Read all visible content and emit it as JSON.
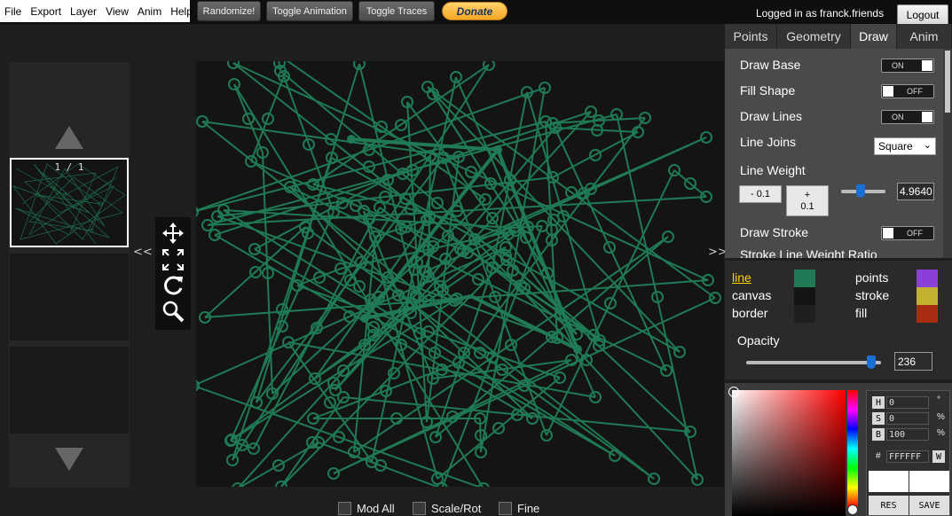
{
  "menu": [
    "File",
    "Export",
    "Layer",
    "View",
    "Anim",
    "Help"
  ],
  "toolbar": {
    "randomize": "Randomize!",
    "toggle_animation": "Toggle Animation",
    "toggle_traces": "Toggle Traces",
    "donate": "Donate"
  },
  "user": {
    "logged_in": "Logged in as franck.friends",
    "logout": "Logout"
  },
  "frames": {
    "counter": "1 / 1",
    "collapse_left": "<<",
    "collapse_right": ">>"
  },
  "tools": [
    "move-icon",
    "scale-icon",
    "rotate-icon",
    "zoom-icon"
  ],
  "bottom": {
    "mod_all": "Mod All",
    "scale_rot": "Scale/Rot",
    "fine": "Fine"
  },
  "tabs": [
    "Points",
    "Geometry",
    "Draw",
    "Anim"
  ],
  "active_tab": "Draw",
  "draw": {
    "draw_base": {
      "label": "Draw Base",
      "state": "ON"
    },
    "fill_shape": {
      "label": "Fill Shape",
      "state": "OFF"
    },
    "draw_lines": {
      "label": "Draw Lines",
      "state": "ON"
    },
    "line_joins": {
      "label": "Line Joins",
      "value": "Square"
    },
    "line_weight": {
      "label": "Line Weight",
      "minus": "- 0.1",
      "plus": "+ 0.1",
      "value": "4.9640",
      "slider": 0.43
    },
    "draw_stroke": {
      "label": "Draw Stroke",
      "state": "OFF"
    },
    "stroke_ratio": {
      "label": "Stroke Line Weight Ratio"
    }
  },
  "colors": {
    "line": {
      "label": "line",
      "hex": "#1f7a55"
    },
    "canvas": {
      "label": "canvas",
      "hex": "#141414"
    },
    "border": {
      "label": "border",
      "hex": "#1f1f1f"
    },
    "points": {
      "label": "points",
      "hex": "#8a3fd6"
    },
    "stroke": {
      "label": "stroke",
      "hex": "#c2b030"
    },
    "fill": {
      "label": "fill",
      "hex": "#a82c10"
    },
    "opacity_label": "Opacity",
    "opacity": "236",
    "opacity_slider": 0.93
  },
  "picker": {
    "h_label": "H",
    "h": "0",
    "h_unit": "°",
    "s_label": "S",
    "s": "0",
    "s_unit": "%",
    "b_label": "B",
    "b": "100",
    "b_unit": "%",
    "hash": "#",
    "hex": "FFFFFF",
    "w": "W",
    "res": "RES",
    "save": "SAVE"
  }
}
